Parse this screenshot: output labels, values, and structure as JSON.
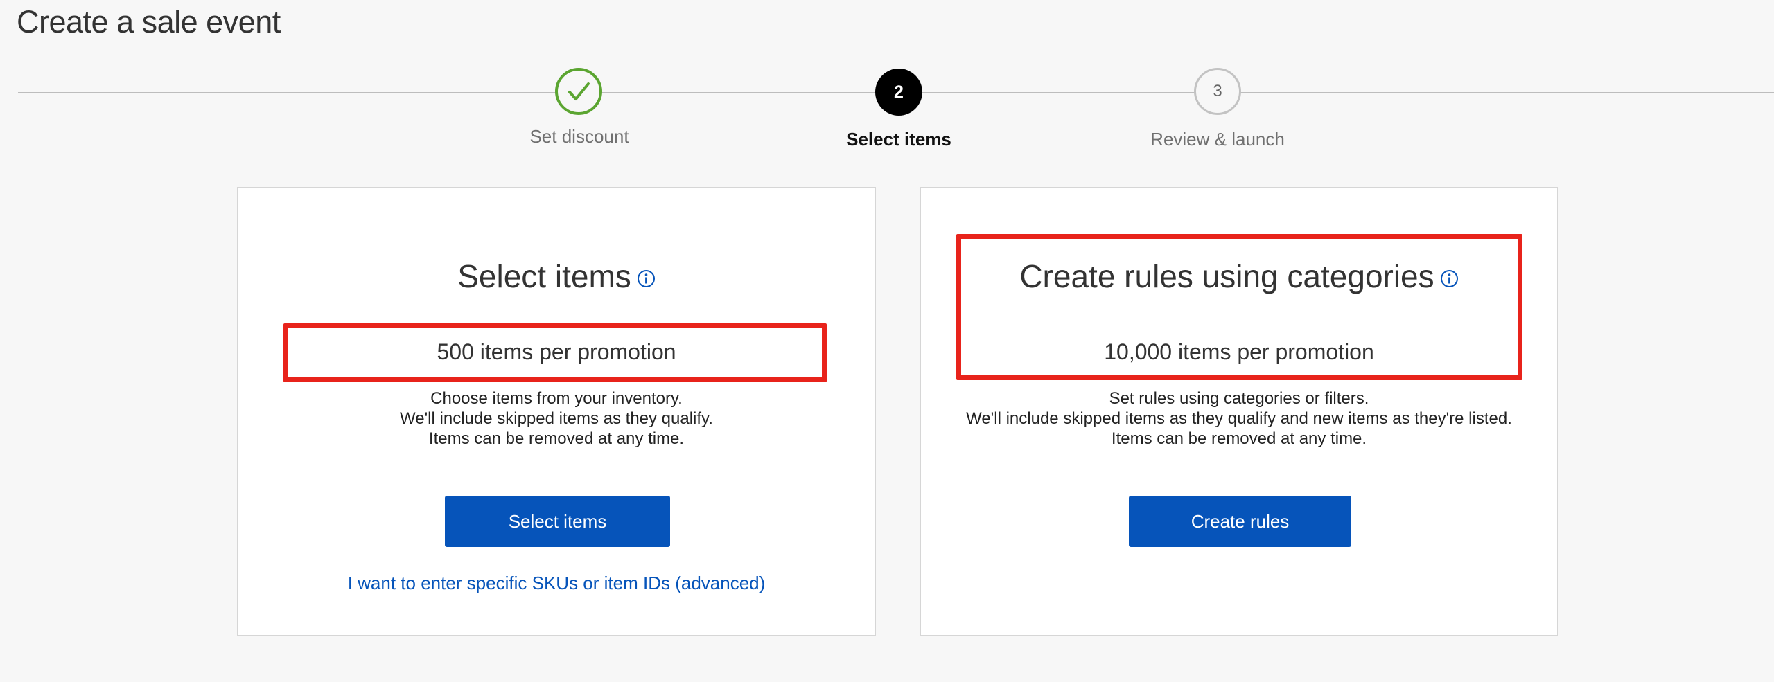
{
  "page": {
    "title": "Create a sale event"
  },
  "stepper": {
    "steps": [
      {
        "number": "1",
        "label": "Set discount",
        "state": "complete"
      },
      {
        "number": "2",
        "label": "Select items",
        "state": "current"
      },
      {
        "number": "3",
        "label": "Review & launch",
        "state": "upcoming"
      }
    ]
  },
  "cards": {
    "select_items": {
      "title": "Select items",
      "capacity": "500 items per promotion",
      "description": [
        "Choose items from your inventory.",
        "We'll include skipped items as they qualify.",
        "Items can be removed at any time."
      ],
      "button_label": "Select items",
      "advanced_link": "I want to enter specific SKUs or item IDs (advanced)"
    },
    "create_rules": {
      "title": "Create rules using categories",
      "capacity": "10,000 items per promotion",
      "description": [
        "Set rules using categories or filters.",
        "We'll include skipped items as they qualify and new items as they're listed.",
        "Items can be removed at any time."
      ],
      "button_label": "Create rules"
    }
  },
  "icons": {
    "complete_step": "checkmark-icon",
    "info": "info-icon"
  },
  "colors": {
    "accent_blue": "#0654ba",
    "success_green": "#5ba531",
    "annotation_red": "#e8231b",
    "active_step": "#000000"
  }
}
